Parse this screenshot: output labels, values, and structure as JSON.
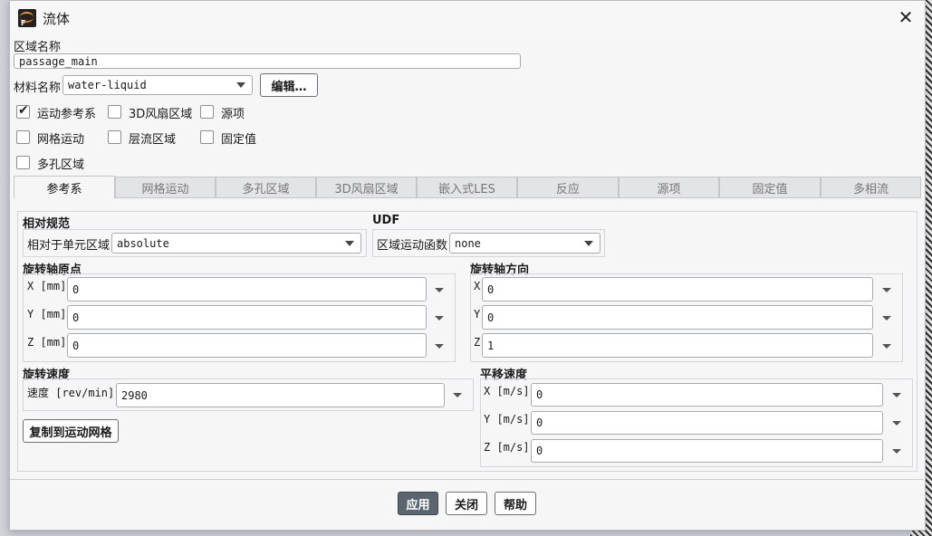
{
  "window": {
    "title": "流体"
  },
  "zone_name": {
    "label": "区域名称",
    "value": "passage_main"
  },
  "material": {
    "label": "材料名称",
    "value": "water-liquid",
    "edit_label": "编辑…"
  },
  "checkboxes": [
    {
      "label": "运动参考系",
      "checked": true
    },
    {
      "label": "3D风扇区域",
      "checked": false
    },
    {
      "label": "源项",
      "checked": false
    },
    {
      "label": "网格运动",
      "checked": false
    },
    {
      "label": "层流区域",
      "checked": false
    },
    {
      "label": "固定值",
      "checked": false
    },
    {
      "label": "多孔区域",
      "checked": false
    }
  ],
  "tabs": [
    "参考系",
    "网格运动",
    "多孔区域",
    "3D风扇区域",
    "嵌入式LES",
    "反应",
    "源项",
    "固定值",
    "多相流"
  ],
  "relative": {
    "title": "相对规范",
    "label": "相对于单元区域",
    "value": "absolute"
  },
  "udf": {
    "title": "UDF",
    "label": "区域运动函数",
    "value": "none"
  },
  "axis_origin": {
    "title": "旋转轴原点",
    "x_label": "X [mm]",
    "x_value": "0",
    "y_label": "Y [mm]",
    "y_value": "0",
    "z_label": "Z [mm]",
    "z_value": "0"
  },
  "axis_direction": {
    "title": "旋转轴方向",
    "x_label": "X",
    "x_value": "0",
    "y_label": "Y",
    "y_value": "0",
    "z_label": "Z",
    "z_value": "1"
  },
  "rotation_speed": {
    "title": "旋转速度",
    "label": "速度 [rev/min]",
    "value": "2980"
  },
  "copy_button": "复制到运动网格",
  "translation_speed": {
    "title": "平移速度",
    "x_label": "X [m/s]",
    "x_value": "0",
    "y_label": "Y [m/s]",
    "y_value": "0",
    "z_label": "Z [m/s]",
    "z_value": "0"
  },
  "footer": {
    "apply": "应用",
    "close": "关闭",
    "help": "帮助"
  }
}
